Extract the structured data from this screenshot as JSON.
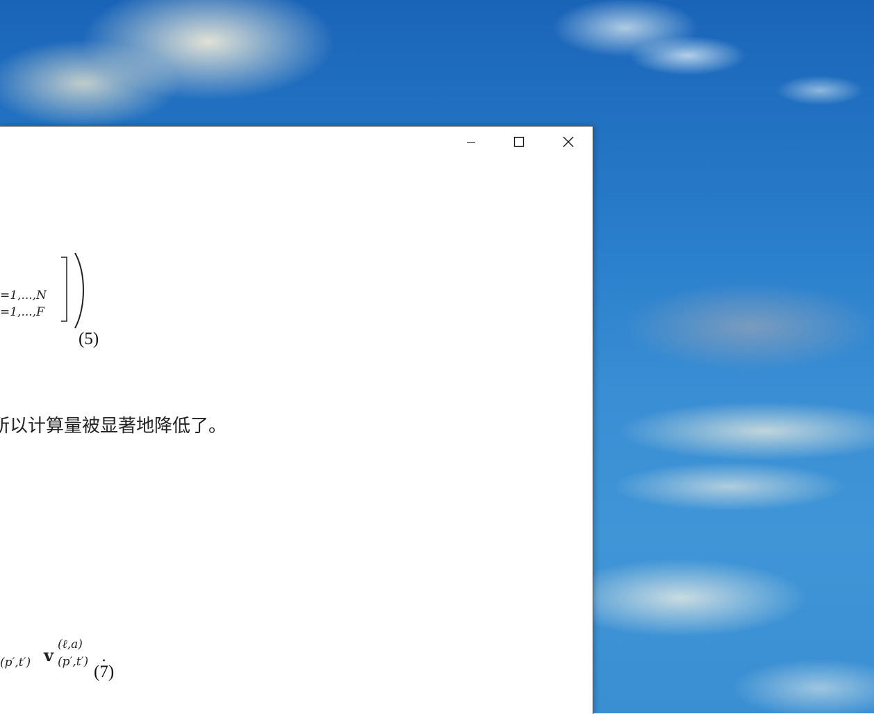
{
  "window": {
    "controls": {
      "minimize_label": "Minimize",
      "maximize_label": "Maximize",
      "close_label": "Close"
    }
  },
  "document": {
    "equation5": {
      "sub_top": "=1,...,N",
      "sub_bottom": "=1,...,F",
      "number": "(5)"
    },
    "paragraph_text": "所以计算量被显著地降低了。",
    "equation7": {
      "left_sub": "(p′,t′)",
      "vector": "v",
      "superscript": "(ℓ,a)",
      "right_sub": "(p′,t′)",
      "period": ".",
      "number": "(7)"
    }
  }
}
